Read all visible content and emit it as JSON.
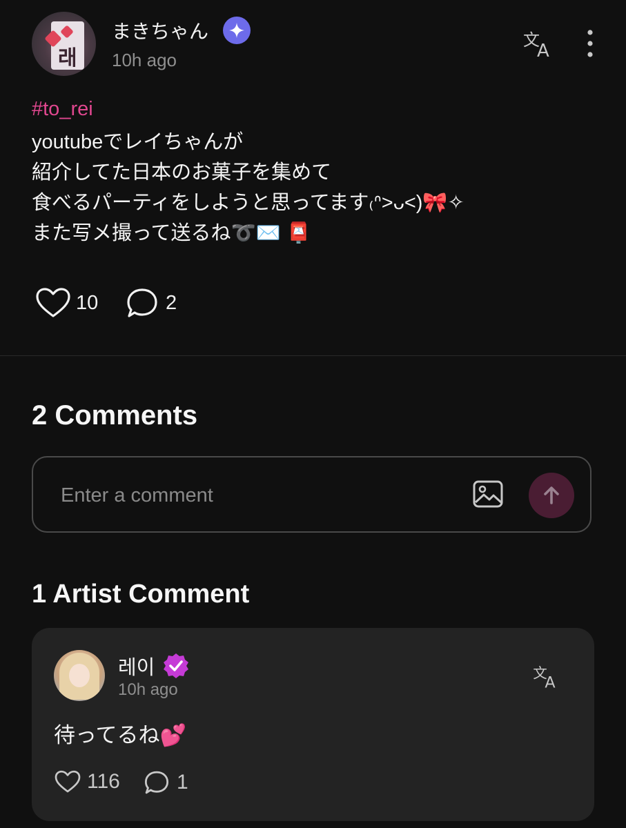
{
  "post": {
    "username": "まきちゃん",
    "avatar_text": "래이",
    "time": "10h ago",
    "hashtag": "#to_rei",
    "body_lines": [
      "youtubeでレイちゃんが",
      "紹介してた日本のお菓子を集めて",
      "食べるパーティをしようと思ってます₍ᐢ>ᴗ<)🎀✧",
      "また写メ撮って送るね➰✉️ 📮"
    ],
    "likes": "10",
    "comments": "2"
  },
  "comments_section": {
    "title": "2 Comments",
    "input_placeholder": "Enter a comment"
  },
  "artist_section": {
    "title": "1 Artist Comment",
    "comment": {
      "name": "레이",
      "time": "10h ago",
      "text": "待ってるね💕",
      "likes": "116",
      "replies": "1"
    }
  },
  "colors": {
    "background": "#101010",
    "hashtag": "#e0478f",
    "badge": "#6d6bea",
    "send_button": "#4a1d33",
    "card": "#232323"
  },
  "icons": [
    "sparkle-badge-icon",
    "translate-icon",
    "more-vertical-icon",
    "heart-icon",
    "comment-bubble-icon",
    "image-icon",
    "arrow-up-icon",
    "verified-badge-icon"
  ]
}
